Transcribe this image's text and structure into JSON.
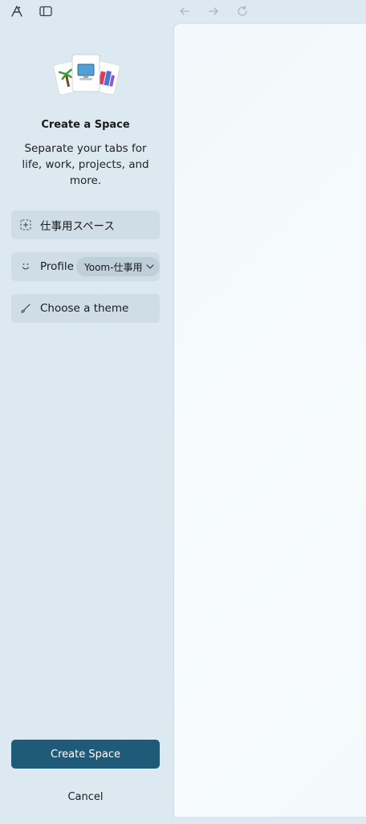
{
  "toolbar": {
    "icons": [
      "copilot-icon",
      "sidebar-toggle-icon",
      "back-arrow-icon",
      "forward-arrow-icon",
      "refresh-icon"
    ]
  },
  "panel": {
    "title": "Create a Space",
    "subtitle": "Separate your tabs for life, work, projects, and more.",
    "space_name_value": "仕事用スペース",
    "profile_label": "Profile",
    "profile_value": "Yoom-仕事用",
    "theme_label": "Choose a theme",
    "create_button": "Create Space",
    "cancel_button": "Cancel"
  },
  "colors": {
    "sidebar_bg": "#dde9f1",
    "field_bg": "#cfdde6",
    "primary": "#1f5a78",
    "content_bg": "#f4f9fb"
  }
}
